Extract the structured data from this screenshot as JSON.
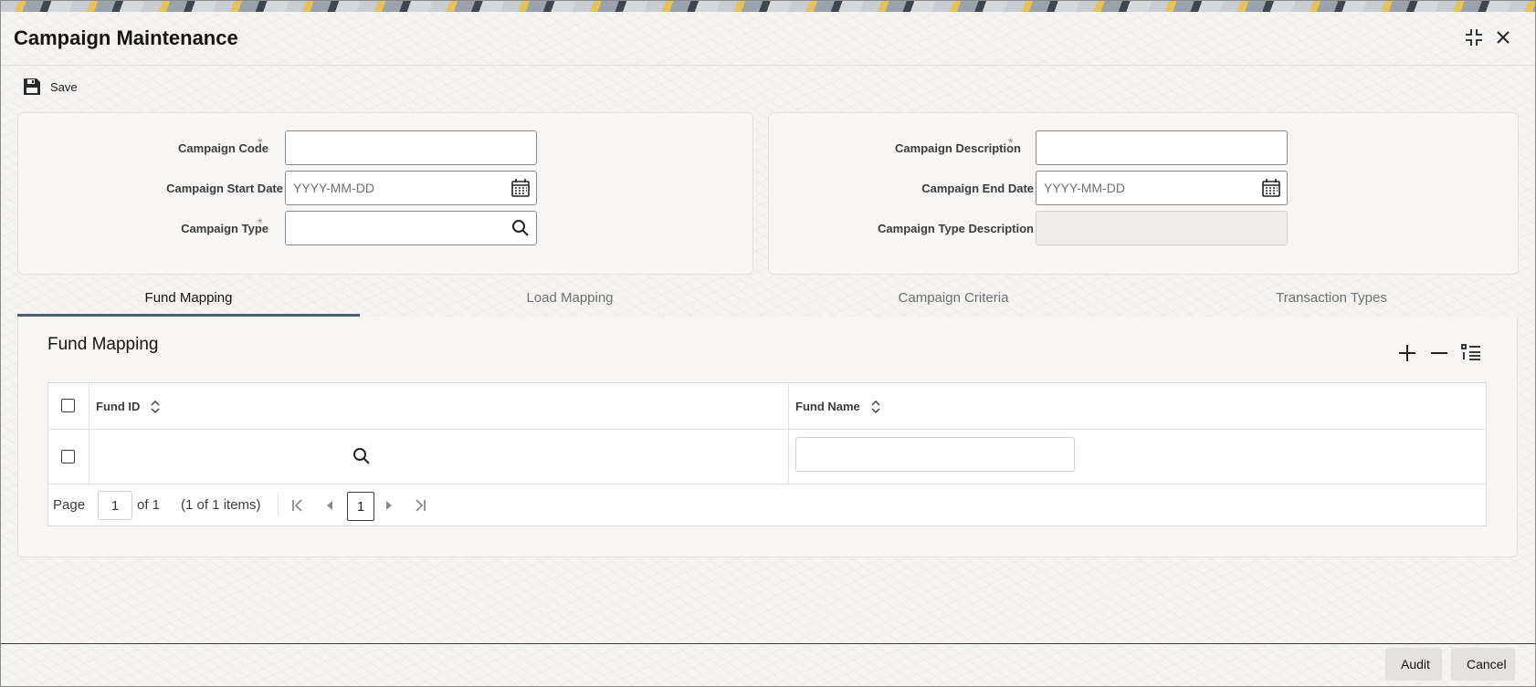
{
  "window": {
    "title": "Campaign Maintenance"
  },
  "toolbar": {
    "save_label": "Save"
  },
  "form": {
    "campaign_code": {
      "label": "Campaign Code",
      "required": "*",
      "value": ""
    },
    "campaign_start_date": {
      "label": "Campaign Start Date",
      "placeholder": "YYYY-MM-DD"
    },
    "campaign_type": {
      "label": "Campaign Type",
      "required": "*",
      "value": ""
    },
    "campaign_description": {
      "label": "Campaign Description",
      "required": "*",
      "value": ""
    },
    "campaign_end_date": {
      "label": "Campaign End Date",
      "placeholder": "YYYY-MM-DD"
    },
    "campaign_type_description": {
      "label": "Campaign Type Description",
      "value": ""
    }
  },
  "tabs": [
    {
      "label": "Fund Mapping",
      "active": true
    },
    {
      "label": "Load Mapping",
      "active": false
    },
    {
      "label": "Campaign Criteria",
      "active": false
    },
    {
      "label": "Transaction Types",
      "active": false
    }
  ],
  "fund_mapping": {
    "title": "Fund Mapping",
    "columns": [
      "Fund ID",
      "Fund Name"
    ],
    "rows": [
      {
        "fund_id": "",
        "fund_name": ""
      }
    ],
    "pagination": {
      "page_label": "Page",
      "page_value": "1",
      "of_label": "of 1",
      "items_label": "(1 of 1 items)",
      "current_page": "1"
    }
  },
  "footer": {
    "audit_label": "Audit",
    "cancel_label": "Cancel"
  },
  "colors": {
    "accent": "#4f5d73",
    "text": "#161513",
    "panel": "#f7f6f4"
  },
  "icons": [
    "minimize-icon",
    "close-icon",
    "save-icon",
    "calendar-icon",
    "search-icon",
    "add-icon",
    "remove-icon",
    "list-icon",
    "sort-icon",
    "first-page-icon",
    "prev-page-icon",
    "next-page-icon",
    "last-page-icon"
  ]
}
